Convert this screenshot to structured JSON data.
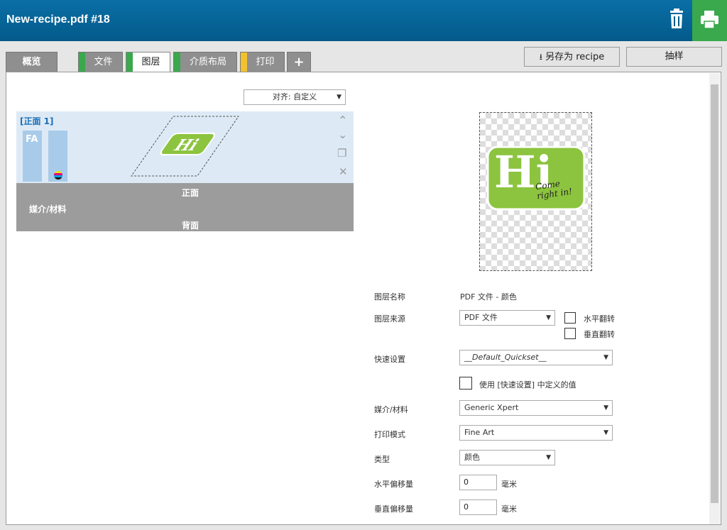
{
  "header": {
    "title": "New-recipe.pdf #18"
  },
  "tabs": [
    {
      "label": "概览",
      "stripe": ""
    },
    {
      "label": "文件",
      "stripe": "#3aa84d"
    },
    {
      "label": "图层",
      "stripe": "#3aa84d"
    },
    {
      "label": "介质布局",
      "stripe": "#3aa84d"
    },
    {
      "label": "打印",
      "stripe": "#f2c12e"
    },
    {
      "label": "+",
      "stripe": ""
    }
  ],
  "toolbar": {
    "save_as_label": "另存为 recipe",
    "sample_label": "抽样"
  },
  "align": {
    "value": "对齐: 自定义"
  },
  "layer_card": {
    "title": "[正面 1]",
    "bar_label": "FA"
  },
  "media": {
    "front": "正面",
    "label": "媒介/材料",
    "back": "背面"
  },
  "preview": {
    "logo_big": "Hi",
    "logo_script_1": "Come",
    "logo_script_2": "right in!"
  },
  "form": {
    "layer_name_label": "图层名称",
    "layer_name_value": "PDF 文件 - 颜色",
    "layer_source_label": "图层来源",
    "layer_source_value": "PDF 文件",
    "flip_h_label": "水平翻转",
    "flip_v_label": "垂直翻转",
    "quickset_label": "快速设置",
    "quickset_value": "__Default_Quickset__",
    "use_quickset_label": "使用 [快速设置] 中定义的值",
    "media_label": "媒介/材料",
    "media_value": "Generic Xpert",
    "print_mode_label": "打印模式",
    "print_mode_value": "Fine Art",
    "type_label": "类型",
    "type_value": "颜色",
    "h_offset_label": "水平偏移量",
    "h_offset_value": "0",
    "h_offset_unit": "毫米",
    "v_offset_label": "垂直偏移量",
    "v_offset_value": "0",
    "v_offset_unit": "毫米"
  },
  "colors": {
    "header_blue": "#035a8a",
    "print_green": "#3aa84d",
    "logo_green": "#8cc43f",
    "active_link": "#1b6fb5"
  }
}
